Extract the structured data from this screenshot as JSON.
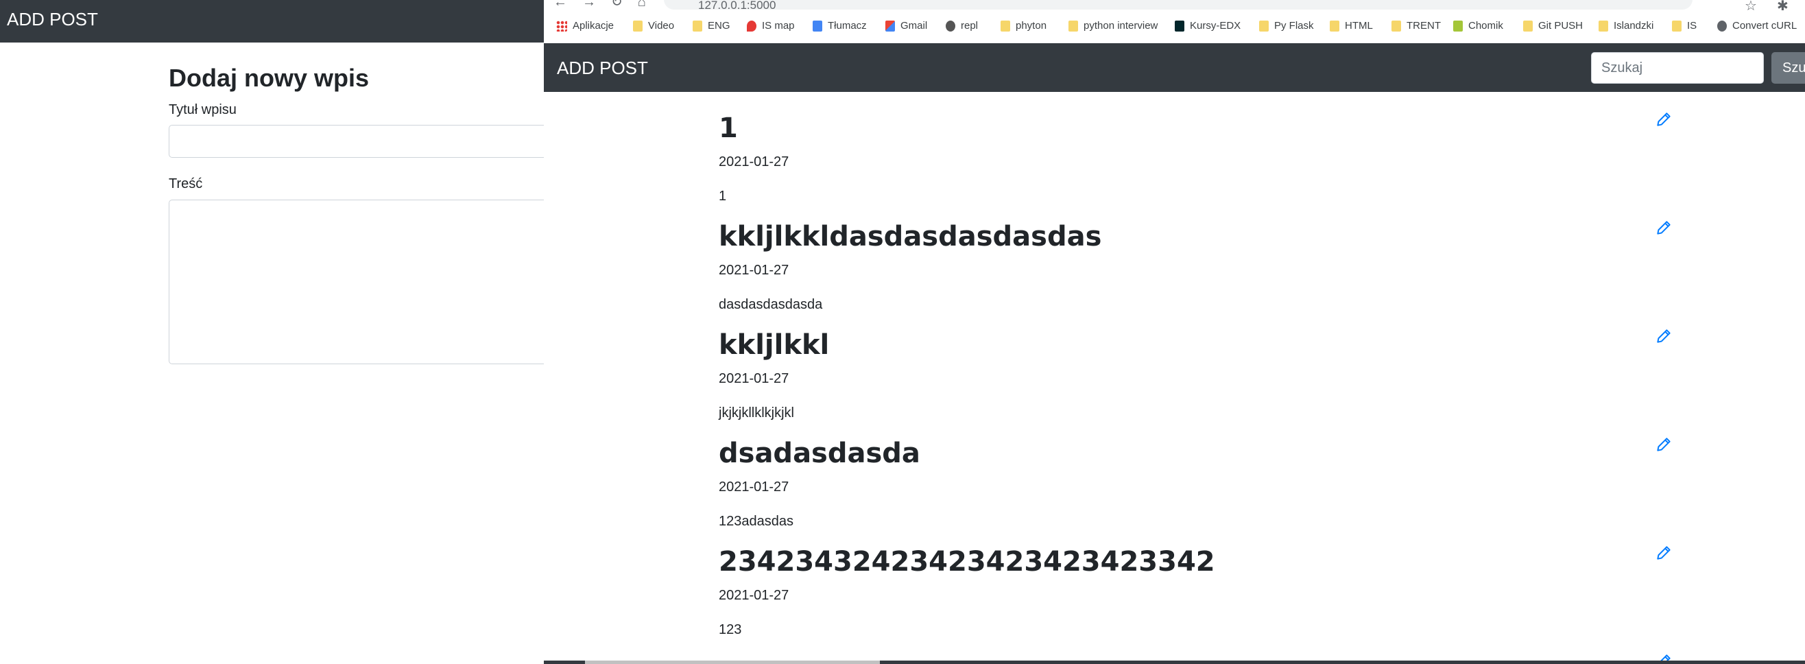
{
  "left": {
    "brand": "ADD POST",
    "heading": "Dodaj nowy wpis",
    "title_label": "Tytuł wpisu",
    "content_label": "Treść"
  },
  "browser": {
    "url": "127.0.0.1:5000",
    "bookmarks": [
      "Aplikacje",
      "Video",
      "ENG",
      "IS map",
      "Tłumacz",
      "Gmail",
      "repl",
      "phyton",
      "python interview",
      "Kursy-EDX",
      "Py Flask",
      "HTML",
      "TRENT",
      "Chomik",
      "Git PUSH",
      "Islandzki",
      "IS",
      "Convert cURL"
    ]
  },
  "navbar": {
    "brand": "ADD POST",
    "search_placeholder": "Szukaj",
    "search_button": "Szu"
  },
  "posts": [
    {
      "title": "1",
      "date": "2021-01-27",
      "body": "1"
    },
    {
      "title": "kkljlkkldasdasdasdasdas",
      "date": "2021-01-27",
      "body": "dasdasdasdasda"
    },
    {
      "title": "kkljlkkl",
      "date": "2021-01-27",
      "body": "jkjkjkllklkjkjkl"
    },
    {
      "title": "dsadasdasda",
      "date": "2021-01-27",
      "body": "123adasdas"
    },
    {
      "title": "23423432423423423423423342",
      "date": "2021-01-27",
      "body": "123"
    }
  ],
  "colors": {
    "navbar": "#343a40",
    "link": "#007bff",
    "button": "#6c757d"
  }
}
